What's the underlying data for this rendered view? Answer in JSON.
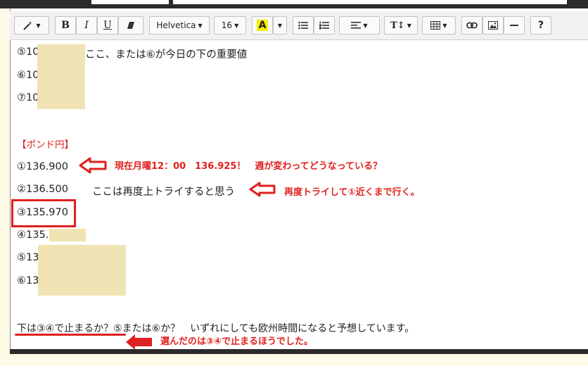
{
  "toolbar": {
    "font_name": "Helvetica",
    "font_size": "16",
    "highlight_letter": "A",
    "text_size_label": "T↕"
  },
  "content": {
    "line5": "⑤10",
    "line5_note": "ここ、または⑥が今日の下の重要値",
    "line6": "⑥10",
    "line7": "⑦10",
    "section": "【ポンド円】",
    "g1": "①136.900",
    "g2": "②136.500",
    "g2_note": "ここは再度上トライすると思う",
    "g3": "③135.970",
    "g4": "④135.",
    "g5": "⑤13",
    "g6": "⑥13",
    "question": "下は③④で止まるか？⑤または⑥か？　いずれにしても欧州時間になると予想しています。"
  },
  "annotations": {
    "a1": "現在月曜12：00　136.925！　週が変わってどうなっている？",
    "a2": "再度トライして①近くまで行く。",
    "a3": "選んだのは③④で止まるほうでした。"
  }
}
